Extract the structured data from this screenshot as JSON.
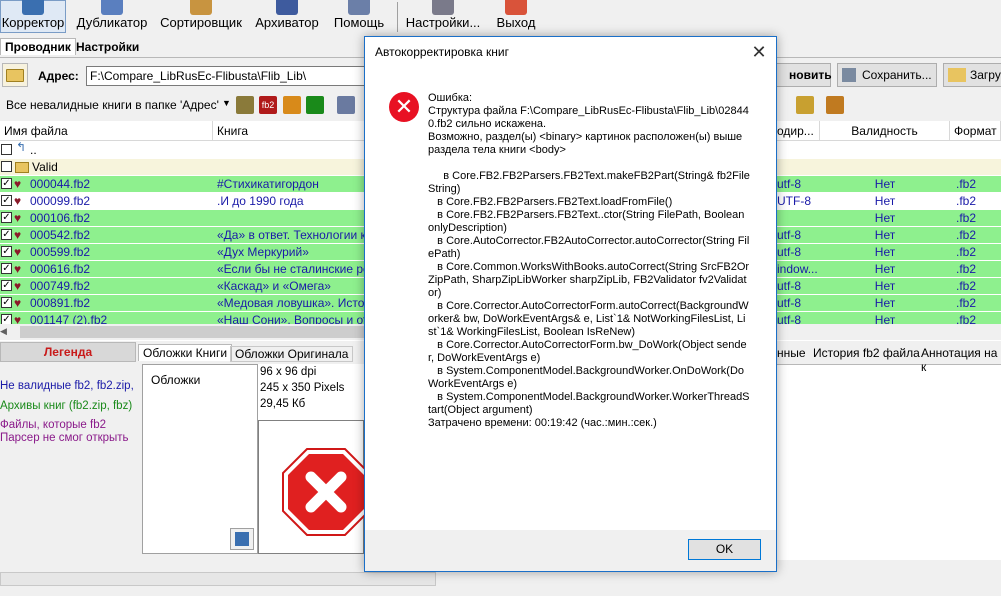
{
  "toolbar": {
    "buttons": [
      {
        "label": "Корректор",
        "active": true
      },
      {
        "label": "Дубликатор",
        "active": false
      },
      {
        "label": "Сортировщик",
        "active": false
      },
      {
        "label": "Архиватор",
        "active": false
      },
      {
        "label": "Помощь",
        "active": false
      },
      {
        "label": "Настройки...",
        "active": false
      },
      {
        "label": "Выход",
        "active": false
      }
    ]
  },
  "main_tabs": [
    "Проводник",
    "Настройки"
  ],
  "address": {
    "label": "Адрес:",
    "value": "F:\\Compare_LibRusEc-Flibusta\\Flib_Lib\\",
    "buttons": [
      "новить",
      "Сохранить...",
      "Загру"
    ]
  },
  "filter": {
    "selected": "Все невалидные книги в папке 'Адрес'"
  },
  "grid": {
    "headers": [
      "Имя файла",
      "Книга",
      "одир...",
      "Валидность",
      "Формат"
    ],
    "up_row": "..",
    "folder_row": "Valid",
    "rows": [
      {
        "file": "000044.fb2",
        "book": "#Стихикатигордон",
        "enc": "utf-8",
        "valid": "Нет",
        "fmt": ".fb2",
        "color": "green"
      },
      {
        "file": "000099.fb2",
        "book": ".И до 1990 года",
        "enc": "UTF-8",
        "valid": "Нет",
        "fmt": ".fb2",
        "color": "white"
      },
      {
        "file": "000106.fb2",
        "book": "",
        "enc": "",
        "valid": "Нет",
        "fmt": ".fb2",
        "color": "green"
      },
      {
        "file": "000542.fb2",
        "book": "«Да» в ответ. Технологии ко",
        "enc": "utf-8",
        "valid": "Нет",
        "fmt": ".fb2",
        "color": "green"
      },
      {
        "file": "000599.fb2",
        "book": "«Дух Меркурий»",
        "enc": "utf-8",
        "valid": "Нет",
        "fmt": ".fb2",
        "color": "green"
      },
      {
        "file": "000616.fb2",
        "book": "«Если бы не сталинские репр",
        "enc": "indow...",
        "valid": "Нет",
        "fmt": ".fb2",
        "color": "green"
      },
      {
        "file": "000749.fb2",
        "book": "«Каскад» и «Омега»",
        "enc": "utf-8",
        "valid": "Нет",
        "fmt": ".fb2",
        "color": "green"
      },
      {
        "file": "000891.fb2",
        "book": "«Медовая ловушка». Истори",
        "enc": "utf-8",
        "valid": "Нет",
        "fmt": ".fb2",
        "color": "green"
      },
      {
        "file": "001147 (2).fb2",
        "book": "«Наш Сони». Вопросы и отв",
        "enc": "utf-8",
        "valid": "Нет",
        "fmt": ".fb2",
        "color": "green"
      }
    ]
  },
  "legend": {
    "title": "Легенда",
    "items": [
      {
        "text": "Не валидные fb2, fb2.zip,",
        "color": "#1a1aa8"
      },
      {
        "text": "Архивы книг (fb2.zip, fbz)",
        "color": "#1a8a1a"
      },
      {
        "text": "Файлы, которые fb2",
        "color": "#8a1a8a"
      },
      {
        "text": "Парсер не смог открыть",
        "color": "#8a1a8a"
      }
    ]
  },
  "cover_tabs": [
    "Обложки Книги",
    "Обложки Оригинала"
  ],
  "cover": {
    "list_header": "Обложки",
    "dpi": "96 x 96 dpi",
    "size": "245 x 350 Pixels",
    "filesize": "29,45 Кб"
  },
  "right_tabs": [
    "нные",
    "История fb2 файла",
    "Аннотация на к"
  ],
  "dialog": {
    "title": "Автокорректировка книг",
    "message": "Ошибка:\nСтруктура файла F:\\Compare_LibRusEc-Flibusta\\Flib_Lib\\028440.fb2 сильно искажена.\nВозможно, раздел(ы) <binary> картинок расположен(ы) выше раздела тела книги <body>\n\n     в Core.FB2.FB2Parsers.FB2Text.makeFB2Part(String& fb2FileString)\n   в Core.FB2.FB2Parsers.FB2Text.loadFromFile()\n   в Core.FB2.FB2Parsers.FB2Text..ctor(String FilePath, Boolean onlyDescription)\n   в Core.AutoCorrector.FB2AutoCorrector.autoCorrector(String FilePath)\n   в Core.Common.WorksWithBooks.autoCorrect(String SrcFB2OrZipPath, SharpZipLibWorker sharpZipLib, FB2Validator fv2Validator)\n   в Core.Corrector.AutoCorrectorForm.autoCorrect(BackgroundWorker& bw, DoWorkEventArgs& e, List`1& NotWorkingFilesList, List`1& WorkingFilesList, Boolean IsReNew)\n   в Core.Corrector.AutoCorrectorForm.bw_DoWork(Object sender, DoWorkEventArgs e)\n   в System.ComponentModel.BackgroundWorker.OnDoWork(DoWorkEventArgs e)\n   в System.ComponentModel.BackgroundWorker.WorkerThreadStart(Object argument)\nЗатрачено времени: 00:19:42 (час.:мин.:сек.)",
    "ok_label": "OK"
  }
}
